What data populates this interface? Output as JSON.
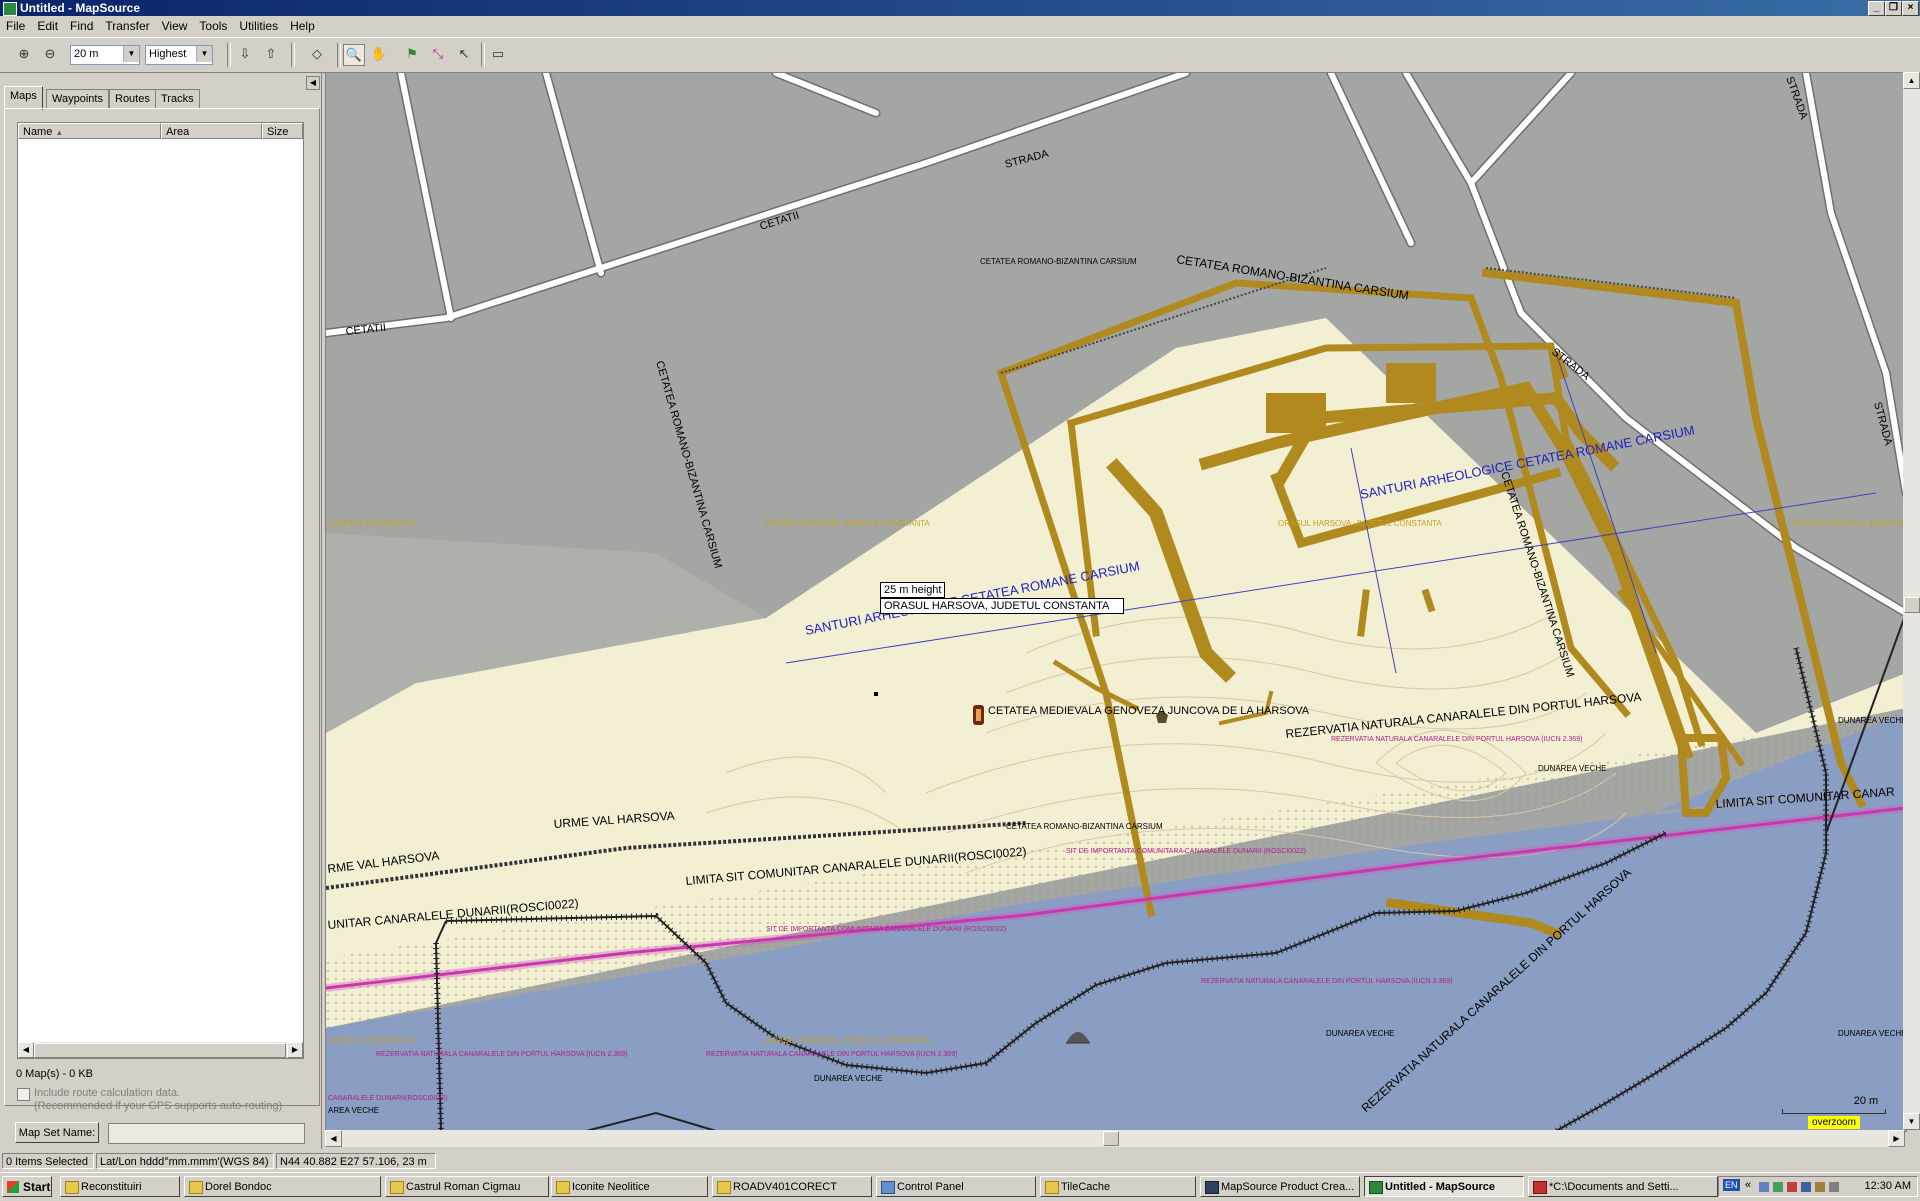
{
  "window": {
    "title": "Untitled - MapSource"
  },
  "menu": [
    "File",
    "Edit",
    "Find",
    "Transfer",
    "View",
    "Tools",
    "Utilities",
    "Help"
  ],
  "toolbar": {
    "zoom_value": "20 m",
    "detail_value": "Highest"
  },
  "tabs": [
    "Maps",
    "Waypoints",
    "Routes",
    "Tracks"
  ],
  "maps_table": {
    "columns": [
      "Name",
      "Area",
      "Size"
    ],
    "summary": "0 Map(s) - 0 KB"
  },
  "options": {
    "route_calc_label": "Include route calculation data.",
    "route_calc_note": "(Recommended if your GPS supports auto-routing)",
    "map_set_name_button": "Map Set Name:"
  },
  "map": {
    "street_labels": [
      "STRADA",
      "CETATII",
      "CETATII",
      "STRADA",
      "STRADA",
      "STRADA"
    ],
    "fortress_labels": [
      "CETATEA ROMANO-BIZANTINA CARSIUM",
      "CETATEA ROMANO-BIZANTINA CARSIUM",
      "CETATEA ROMANO-BIZANTINA CARSIUM",
      "CETATEA ROMANO-BIZANTINA CARSIUM",
      "CETATEA ROMANO-BIZANTINA CARSIUM"
    ],
    "santuri_label": "SANTURI ARHEOLOGICE CETATEA ROMANE CARSIUM",
    "town_label": "ORASUL HARSOVA, JUDETUL CONSTANTA",
    "judet_label": "JUDETUL CONSTANTA",
    "judet_label_right": "ORASUL HARSOVA, JUDETUL",
    "poi_label": "CETATEA MEDIEVALA GENOVEZA JUNCOVA DE LA HARSOVA",
    "rezervatie_big": "REZERVATIA NATURALA CANARALELE DIN PORTUL HARSOVA",
    "rezervatie_small": "REZERVATIA NATURALA CANARALELE DIN PORTUL HARSOVA (IUCN 2.369)",
    "limita_label": "LIMITA SIT COMUNITAR CANARALELE DUNARII(ROSCI0022)",
    "limita_left": "UNITAR CANARALELE DUNARII(ROSCI0022)",
    "limita_right": "LIMITA SIT COMUNITAR CANAR",
    "sit_label": "SIT DE IMPORTANTA COMUNITARA CANARALELE DUNARII (ROSCI0022)",
    "urme_label": "URME VAL HARSOVA",
    "urme_left": "RME VAL HARSOVA",
    "dunarea": "DUNAREA VECHE",
    "canaralele_left": "CANARALELE DUNARII(ROSCI0022)",
    "area_veche": "AREA VECHE",
    "tooltip_height": "25 m height",
    "tooltip_name": "ORASUL HARSOVA, JUDETUL CONSTANTA",
    "scale_label": "20 m",
    "overzoom": "overzoom"
  },
  "status": {
    "items_selected": "0 Items Selected",
    "coord_format": "Lat/Lon hddd°mm.mmm'(WGS 84)",
    "position": "N44 40.882 E27 57.106, 23 m"
  },
  "taskbar": {
    "start": "Start",
    "tasks": [
      "Reconstituiri",
      "Dorel Bondoc",
      "Castrul Roman Cigmau",
      "Iconite Neolitice",
      "ROADV401CORECT",
      "Control Panel",
      "TileCache",
      "MapSource Product Crea...",
      "Untitled - MapSource",
      "*C:\\Documents and Setti..."
    ],
    "clock": "12:30 AM",
    "lang": "EN"
  },
  "colors": {
    "fortress": "#b08a1e",
    "river": "#8a9dc2",
    "land": "#f3efd3",
    "urban": "#a3a6a3",
    "street": "#ffffff",
    "santuri": "#2020c0",
    "limita": "#c020a0"
  }
}
